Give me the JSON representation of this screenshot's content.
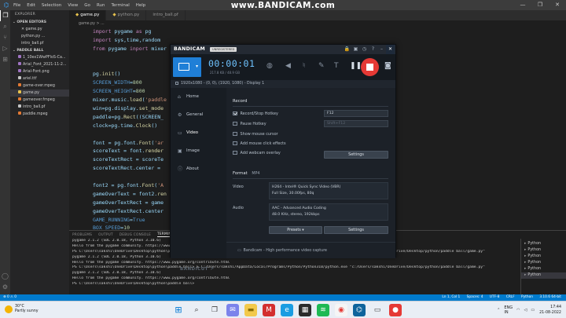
{
  "vscode": {
    "menu": [
      "File",
      "Edit",
      "Selection",
      "View",
      "Go",
      "Run",
      "Terminal",
      "Help"
    ],
    "window_controls": [
      "—",
      "❐",
      "✕"
    ],
    "explorer_title": "EXPLORER",
    "open_editors": "OPEN EDITORS",
    "open_editor_files": [
      "✕ game.py",
      "python.py ...",
      "intro_ball.pf"
    ],
    "folder_title": "PADDLE BALL",
    "files": [
      "1_10ex1WwPFloS-Ca...",
      "Arial_Font_2021-11-2...",
      "Arial-Font.png",
      "ariel.ttf",
      "game-over.mpeg",
      "game.py",
      "gameover.fmpeg",
      "intro_ball.pf",
      "paddle.mpeg"
    ],
    "tabs": [
      "game.py",
      "python.py",
      "intro_ball.pf"
    ],
    "breadcrumb": "game.py > ...",
    "code_lines": [
      [
        [
          "kw",
          "import "
        ],
        [
          "var",
          "pygame "
        ],
        [
          "kw",
          "as "
        ],
        [
          "var",
          "pg"
        ]
      ],
      [
        [
          "kw",
          "import "
        ],
        [
          "var",
          "sys,time,random"
        ]
      ],
      [
        [
          "kw",
          "from "
        ],
        [
          "var",
          "pygame "
        ],
        [
          "kw",
          "inport "
        ],
        [
          "var",
          "mixer"
        ]
      ],
      [],
      [],
      [
        [
          "var",
          "pg"
        ],
        [
          "fn",
          ".init"
        ],
        [
          "var",
          "()"
        ]
      ],
      [
        [
          "const",
          "SCREEN_WIDTH"
        ],
        [
          "var",
          "="
        ],
        [
          "num",
          "800"
        ]
      ],
      [
        [
          "const",
          "SCREEN_HEIGHT"
        ],
        [
          "var",
          "="
        ],
        [
          "num",
          "800"
        ]
      ],
      [
        [
          "var",
          "mixer.music."
        ],
        [
          "fn",
          "load"
        ],
        [
          "var",
          "("
        ],
        [
          "str",
          "'paddle"
        ]
      ],
      [
        [
          "var",
          "win=pg.display."
        ],
        [
          "fn",
          "set_mode"
        ]
      ],
      [
        [
          "var",
          "paddle=pg."
        ],
        [
          "fn",
          "Rect"
        ],
        [
          "var",
          "((SCREEN_"
        ]
      ],
      [
        [
          "var",
          "clock=pg.time."
        ],
        [
          "fn",
          "Clock"
        ],
        [
          "var",
          "()"
        ]
      ],
      [],
      [
        [
          "var",
          "font = pg.font."
        ],
        [
          "fn",
          "Font"
        ],
        [
          "var",
          "("
        ],
        [
          "str",
          "'ar"
        ]
      ],
      [
        [
          "var",
          "scoreText = font."
        ],
        [
          "fn",
          "render"
        ]
      ],
      [
        [
          "var",
          "scoreTextRect = scoreTe"
        ]
      ],
      [
        [
          "var",
          "scoreTextRect.center = "
        ]
      ],
      [],
      [
        [
          "var",
          "font2 = pg.font."
        ],
        [
          "fn",
          "Font"
        ],
        [
          "var",
          "("
        ],
        [
          "str",
          "'A"
        ]
      ],
      [
        [
          "var",
          "gameOverText = font2."
        ],
        [
          "fn",
          "ren"
        ]
      ],
      [
        [
          "var",
          "gameOverTextRect = game"
        ]
      ],
      [
        [
          "var",
          "gameOverTextRect.center"
        ]
      ],
      [
        [
          "const",
          "GAME_RUNNING"
        ],
        [
          "var",
          "="
        ],
        [
          "const",
          "True"
        ]
      ],
      [
        [
          "const",
          "BOX_SPEED"
        ],
        [
          "var",
          "="
        ],
        [
          "num",
          "10"
        ]
      ]
    ],
    "panel_tabs": [
      "PROBLEMS",
      "OUTPUT",
      "DEBUG CONSOLE",
      "TERMINAL"
    ],
    "terminal_lines": [
      "pygame 2.1.2 (SDL 2.0.18, Python 3.10.6)",
      "Hello from the pygame community. https://www.pygame.org/contribute.html",
      "PS C:\\Users\\sakshi\\OneDrive\\Desktop\\python\\paddle ball> & C:/Users/sakshi/AppData/Local/Programs/Python/Python310/python.exe \"c:/Users/sakshi/OneDrive/Desktop/python/paddle ball/game.py\"",
      "pygame 2.1.2 (SDL 2.0.18, Python 3.10.6)",
      "Hello from the pygame community. https://www.pygame.org/contribute.html",
      "PS C:\\Users\\sakshi\\OneDrive\\Desktop\\python\\paddle ball> & C:/Users/sakshi/AppData/Local/Programs/Python/Python310/python.exe \"c:/Users/sakshi/OneDrive/Desktop/python/paddle ball/game.py\"",
      "pygame 2.1.2 (SDL 2.0.18, Python 3.10.6)",
      "Hello from the pygame community. https://www.pygame.org/contribute.html",
      "PS C:\\Users\\sakshi\\OneDrive\\Desktop\\python\\paddle ball>"
    ],
    "terminal_list": [
      "Python",
      "Python",
      "Python",
      "Python",
      "Python",
      "Python"
    ],
    "status_left": "⊗ 0 ⚠ 0",
    "status_right": [
      "Ln 1, Col 1",
      "Spaces: 4",
      "UTF-8",
      "CRLF",
      "Python",
      "3.10.6 64-bit"
    ]
  },
  "watermark": "www.BANDICAM.com",
  "bandicam": {
    "logo": "BANDICAM",
    "badge": "UNREGISTERED",
    "timer": "00:00:01",
    "size": "217.8 KB / 48.9 GB",
    "resolution": "1920x1080 - (0, 0), (1920, 1080) - Display 1",
    "nav": [
      "Home",
      "General",
      "Video",
      "Image",
      "About"
    ],
    "nav_icons": [
      "⌂",
      "⚙",
      "▭",
      "▣",
      "ⓘ"
    ],
    "record": {
      "title": "Record",
      "options": [
        {
          "label": "Record/Stop Hotkey",
          "checked": true,
          "hotkey": "F12"
        },
        {
          "label": "Pause Hotkey",
          "checked": false,
          "hotkey": "Shift+F12"
        },
        {
          "label": "Show mouse cursor",
          "checked": false
        },
        {
          "label": "Add mouse click effects",
          "checked": false
        },
        {
          "label": "Add webcam overlay",
          "checked": false
        }
      ],
      "settings_btn": "Settings"
    },
    "format": {
      "title": "Format",
      "type": "MP4",
      "video_label": "Video",
      "video_lines": [
        "H264 - Intel® Quick Sync Video (VBR)",
        "Full Size, 30.00fps, 80q"
      ],
      "audio_label": "Audio",
      "audio_lines": [
        "AAC - Advanced Audio Coding",
        "48.0 KHz, stereo, 192kbps"
      ],
      "presets_btn": "Presets",
      "settings_btn": "Settings"
    },
    "footer": "Bandicam - High performance video capture",
    "bottom_logo": "BANDICUT ↗"
  },
  "taskbar": {
    "weather_temp": "30°C",
    "weather_desc": "Partly sunny",
    "lang": "ENG\nIN",
    "time": "17:44",
    "date": "21-08-2022"
  },
  "colors": {
    "vscode_accent": "#007acc",
    "bandicam_blue": "#1f7fd7",
    "record_red": "#e53935"
  }
}
